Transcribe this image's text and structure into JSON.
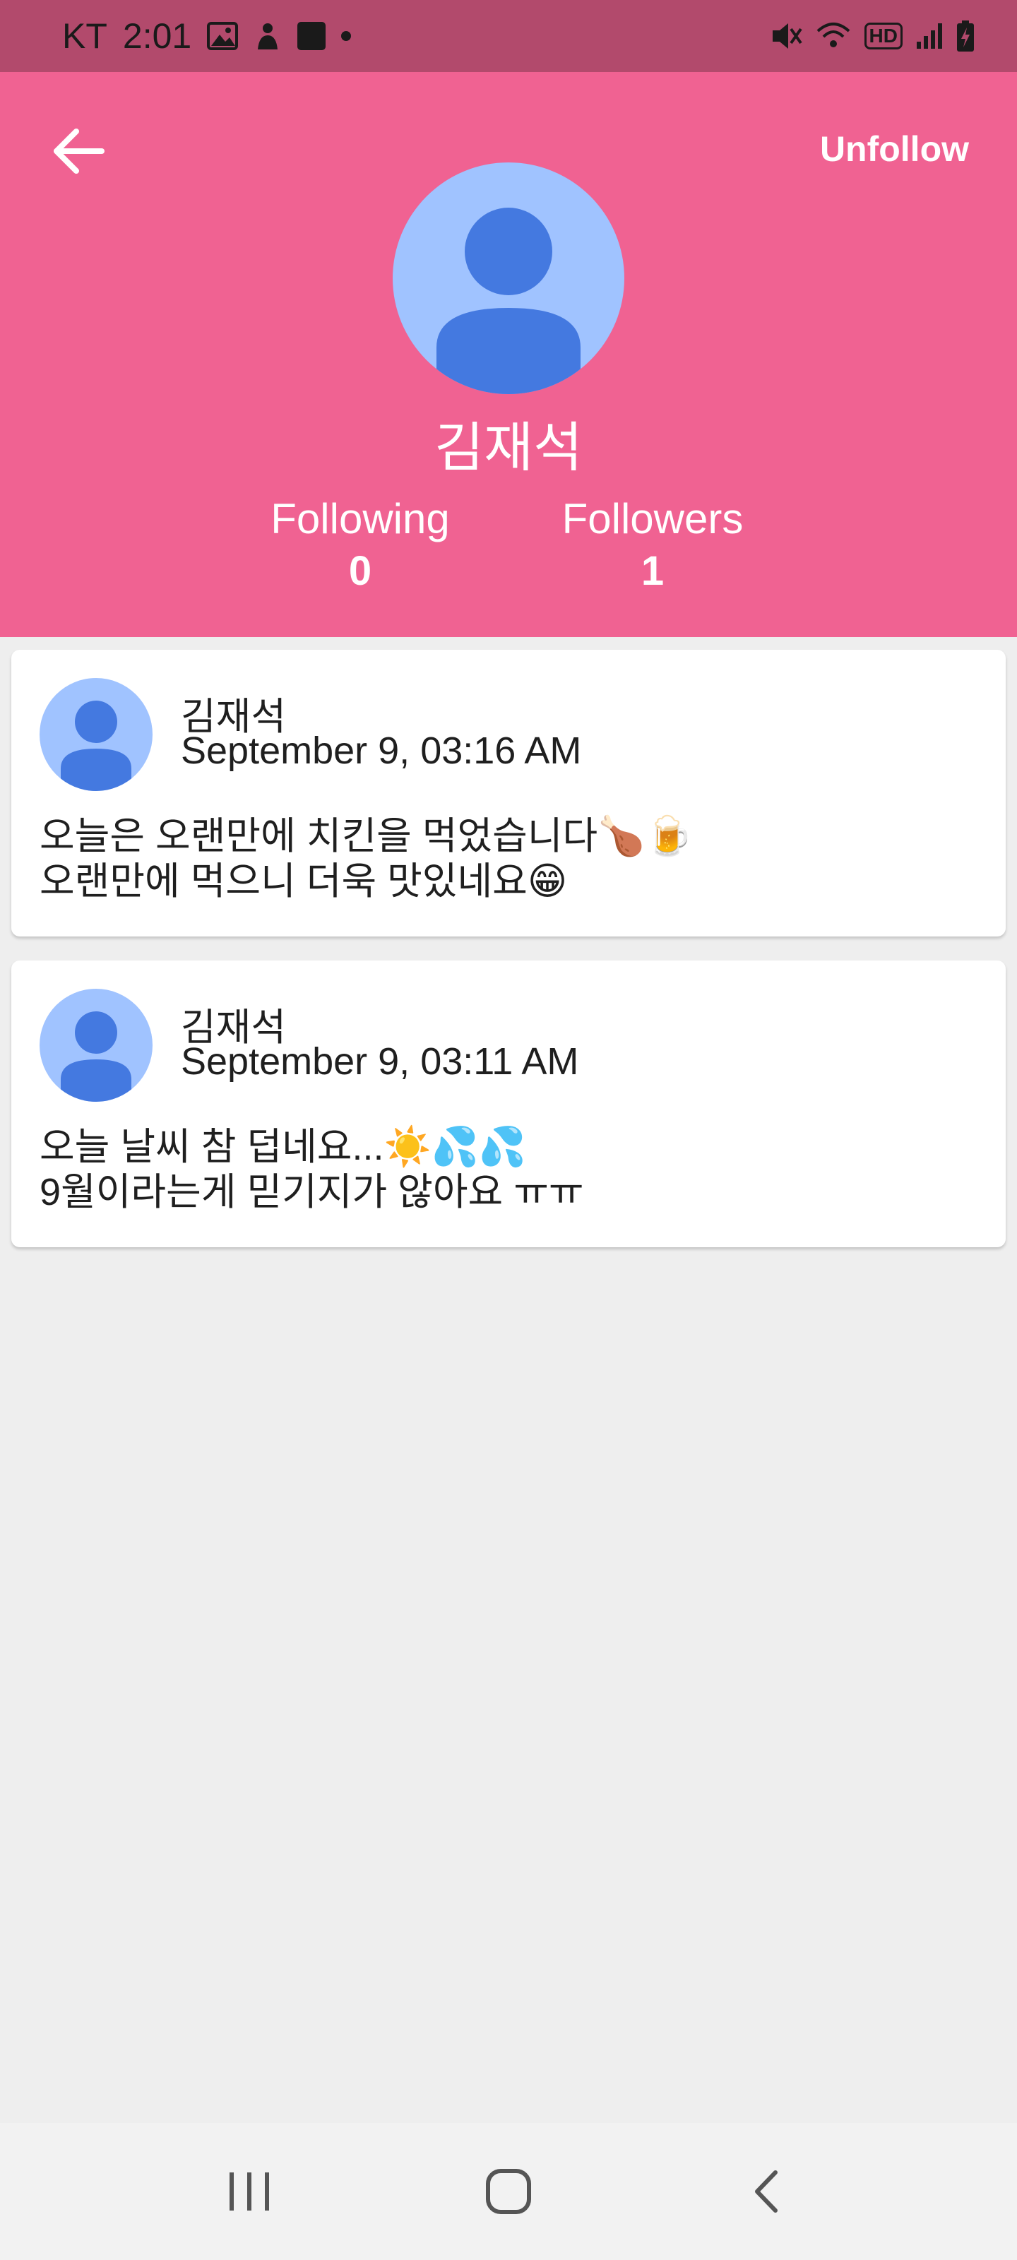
{
  "status_bar": {
    "carrier": "KT",
    "time": "2:01",
    "icons": [
      "image-icon",
      "hand-icon",
      "note-icon",
      "dot-icon",
      "mute-icon",
      "wifi-icon",
      "hd-icon",
      "signal-icon",
      "battery-charging-icon"
    ],
    "hd_label": "HD"
  },
  "header": {
    "back_icon": "arrow-back-icon",
    "unfollow_label": "Unfollow",
    "profile_name": "김재석",
    "following_label": "Following",
    "following_count": "0",
    "followers_label": "Followers",
    "followers_count": "1",
    "background_color": "#f06292"
  },
  "posts": [
    {
      "author": "김재석",
      "date": "September 9, 03:16 AM",
      "body": "오늘은 오랜만에 치킨을 먹었습니다🍗🍺\n오랜만에 먹으니 더욱 맛있네요😁"
    },
    {
      "author": "김재석",
      "date": "September 9, 03:11 AM",
      "body": "오늘 날씨 참 덥네요...☀️💦💦\n9월이라는게 믿기지가 않아요 ㅠㅠ"
    }
  ],
  "nav_bar": {
    "icons": [
      "recent-apps-icon",
      "home-icon",
      "back-icon"
    ]
  },
  "colors": {
    "accent": "#f06292",
    "status_bar": "#b24a6c",
    "avatar_bg": "#a0c3ff",
    "avatar_fg": "#4479e0"
  }
}
